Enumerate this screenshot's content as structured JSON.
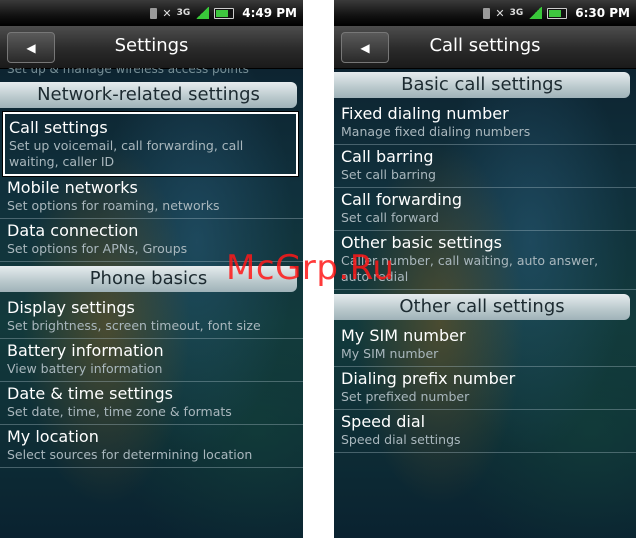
{
  "left": {
    "status": {
      "time": "4:49 PM",
      "network": "3G"
    },
    "title": "Settings",
    "partial_text": "Set up & manage wireless access points",
    "sections": [
      {
        "header": "Network-related settings",
        "items": [
          {
            "title": "Call settings",
            "subtitle": "Set up voicemail, call forwarding, call waiting, caller ID",
            "selected": true
          },
          {
            "title": "Mobile networks",
            "subtitle": "Set options for roaming, networks"
          },
          {
            "title": "Data connection",
            "subtitle": "Set options for APNs, Groups"
          }
        ]
      },
      {
        "header": "Phone basics",
        "items": [
          {
            "title": "Display settings",
            "subtitle": "Set brightness, screen timeout, font size"
          },
          {
            "title": "Battery information",
            "subtitle": "View battery information"
          },
          {
            "title": "Date & time settings",
            "subtitle": "Set date, time, time zone & formats"
          },
          {
            "title": "My location",
            "subtitle": "Select sources for determining location"
          }
        ]
      }
    ]
  },
  "right": {
    "status": {
      "time": "6:30 PM",
      "network": "3G"
    },
    "title": "Call settings",
    "sections": [
      {
        "header": "Basic call settings",
        "items": [
          {
            "title": "Fixed dialing number",
            "subtitle": "Manage fixed dialing numbers"
          },
          {
            "title": "Call barring",
            "subtitle": "Set call barring"
          },
          {
            "title": "Call forwarding",
            "subtitle": "Set call forward"
          },
          {
            "title": "Other basic settings",
            "subtitle": "Caller number, call waiting, auto answer, auto redial"
          }
        ]
      },
      {
        "header": "Other call settings",
        "items": [
          {
            "title": "My SIM number",
            "subtitle": "My SIM number"
          },
          {
            "title": "Dialing prefix number",
            "subtitle": "Set prefixed number"
          },
          {
            "title": "Speed dial",
            "subtitle": "Speed dial settings"
          }
        ]
      }
    ]
  },
  "watermark": "McGrp.Ru",
  "colors": {
    "section_header_bg": "#c3d1d5",
    "item_title": "#ffffff",
    "item_subtitle": "#a9b7bd",
    "watermark": "#ff1818"
  }
}
